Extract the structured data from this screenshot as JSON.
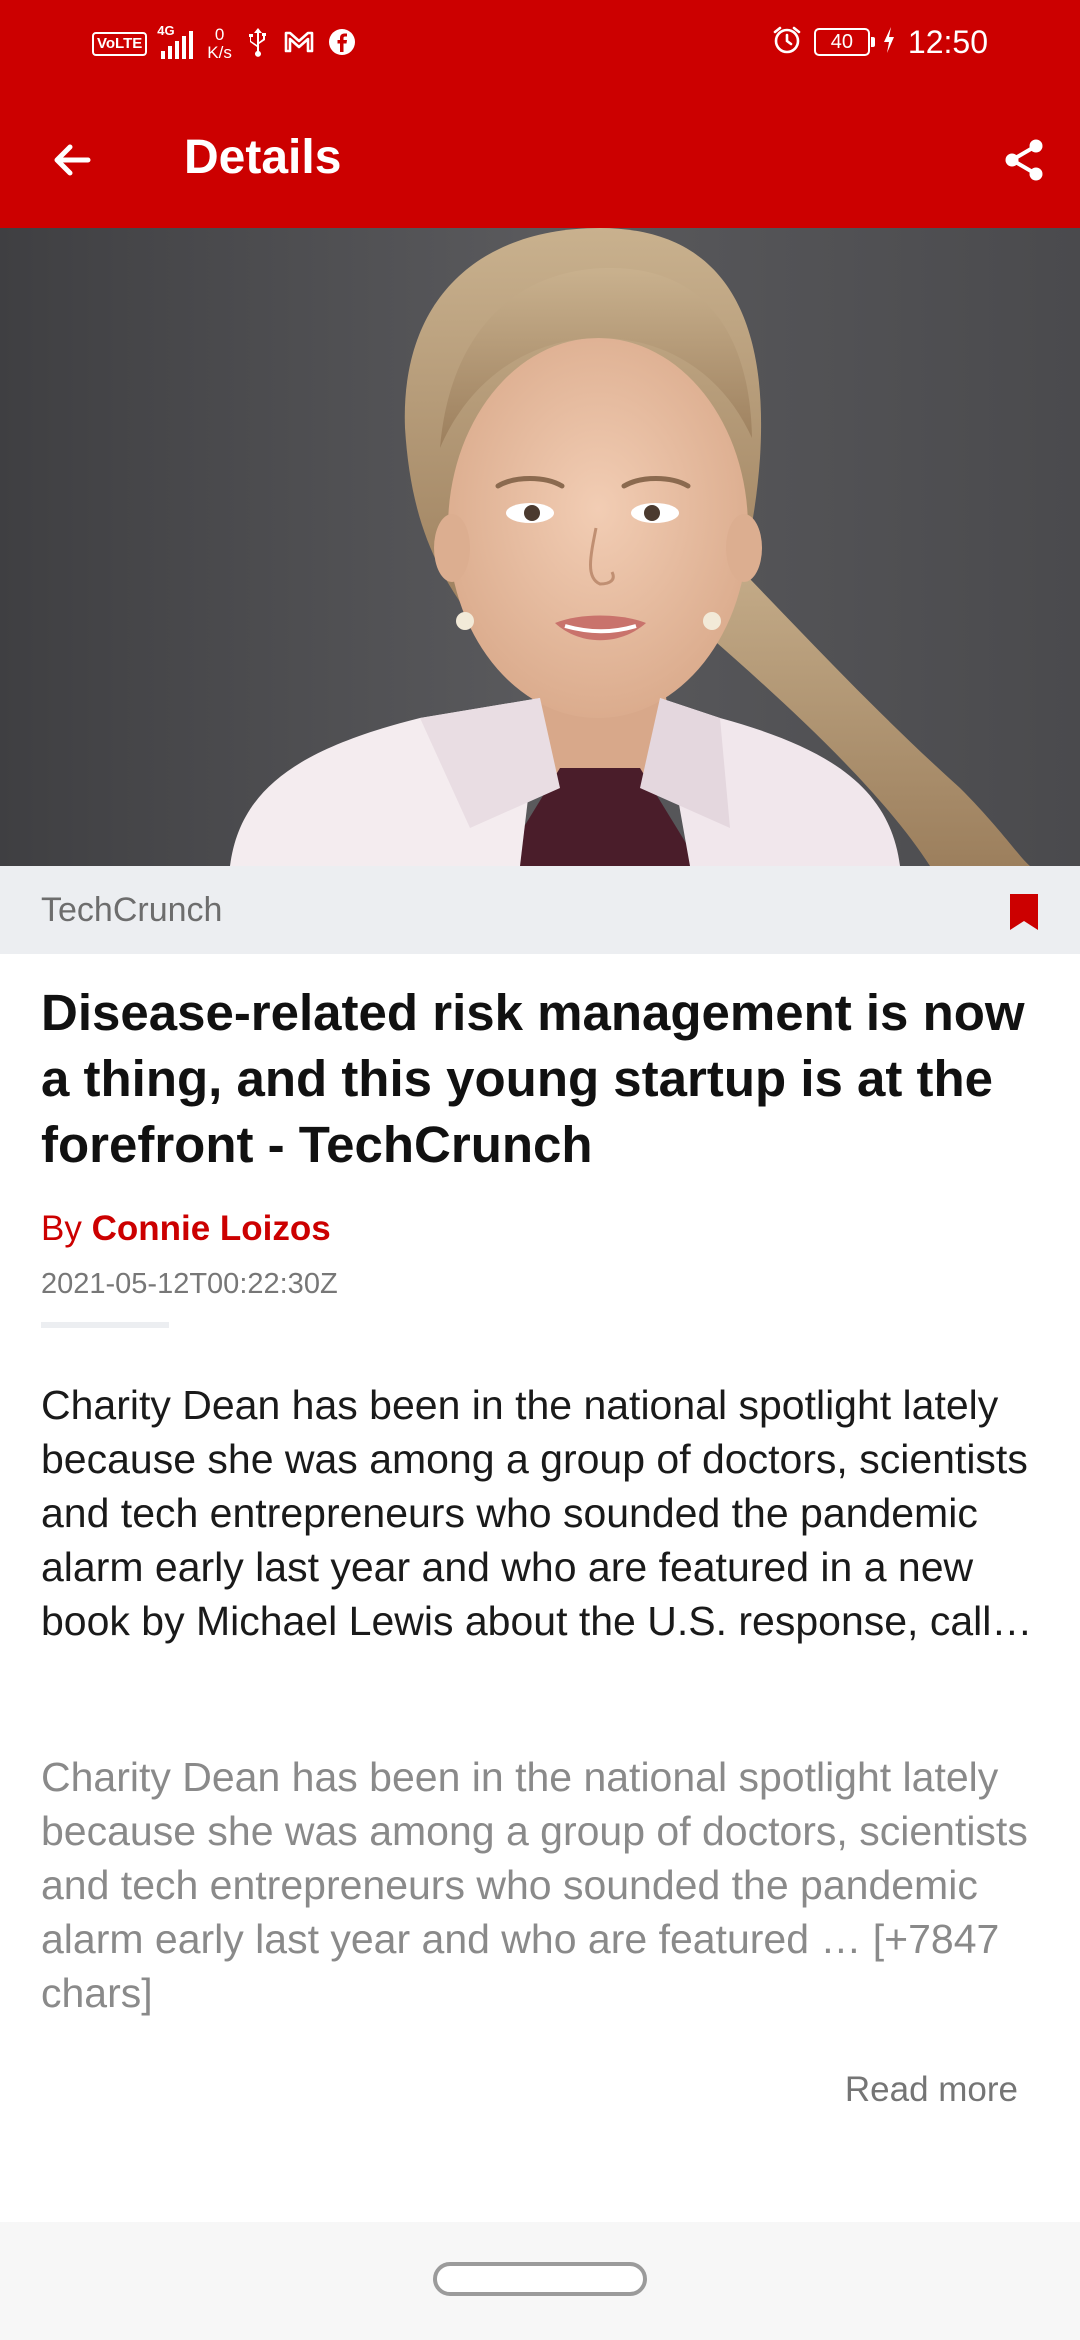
{
  "status_bar": {
    "volte": "VoLTE",
    "network": "4G",
    "speed_value": "0",
    "speed_unit": "K/s",
    "battery": "40",
    "time": "12:50",
    "icons": [
      "usb-icon",
      "gmail-icon",
      "facebook-icon",
      "alarm-icon",
      "charging-icon"
    ]
  },
  "app_bar": {
    "title": "Details",
    "back_icon": "arrow-left-icon",
    "share_icon": "share-icon"
  },
  "article": {
    "source": "TechCrunch",
    "headline": "Disease-related risk management is now a thing, and this young startup is at the forefront - TechCrunch",
    "by_label": "By ",
    "author": "Connie Loizos",
    "published": "2021-05-12T00:22:30Z",
    "description": "Charity Dean has been in the national spotlight lately because she was among a group of doctors, scientists and tech entrepreneurs who sounded the pandemic alarm early last year and who are featured in a new book by Michael Lewis about the U.S. response, call…",
    "content": "Charity Dean has been in the national spotlight lately because she was among a group of doctors, scientists and tech entrepreneurs who sounded the pandemic alarm early last year and who are featured … [+7847 chars]",
    "read_more": "Read more"
  },
  "colors": {
    "brand_red": "#cc0000",
    "source_bar": "#eceef1",
    "headline": "#111111",
    "muted_text": "#8a8a8a"
  }
}
